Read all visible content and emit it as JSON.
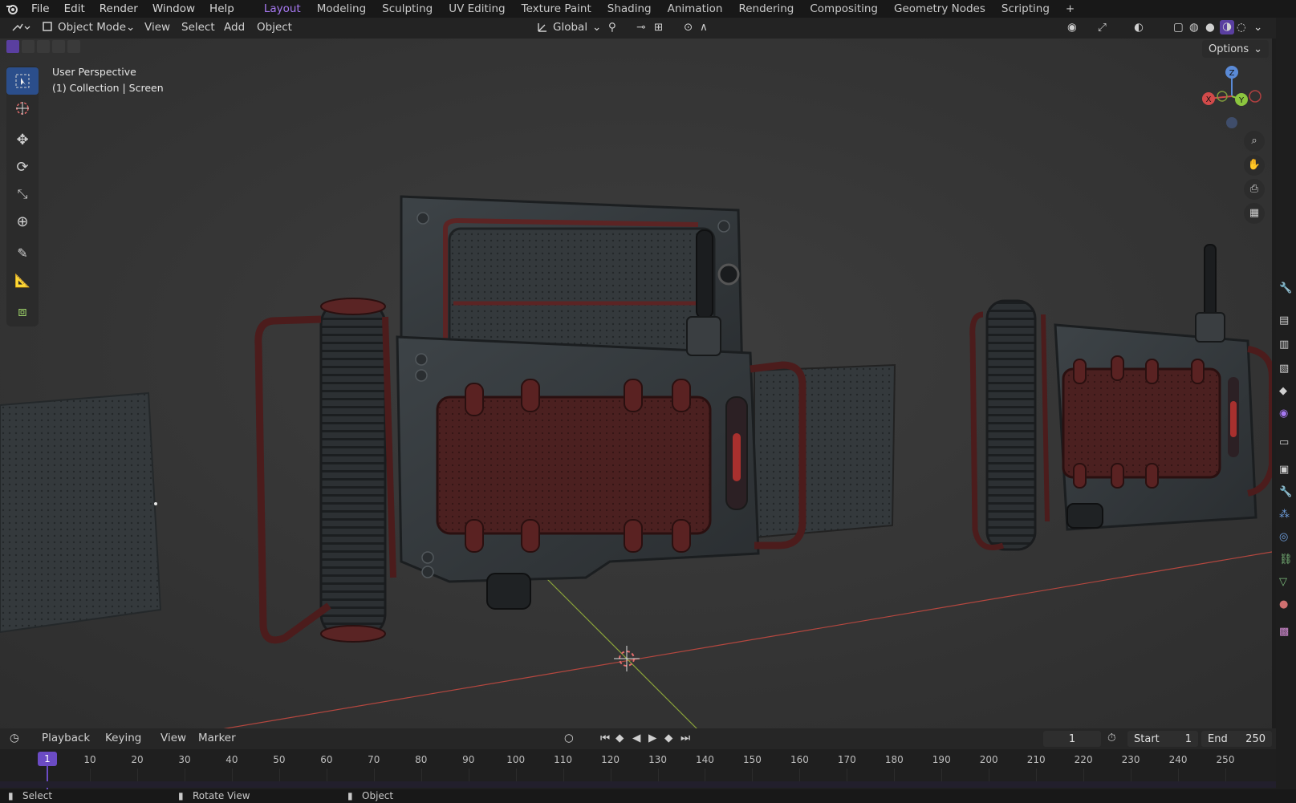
{
  "menu": {
    "file": "File",
    "edit": "Edit",
    "render": "Render",
    "window": "Window",
    "help": "Help"
  },
  "workspaces": [
    "Layout",
    "Modeling",
    "Sculpting",
    "UV Editing",
    "Texture Paint",
    "Shading",
    "Animation",
    "Rendering",
    "Compositing",
    "Geometry Nodes",
    "Scripting"
  ],
  "workspace_add": "+",
  "header": {
    "mode": "Object Mode",
    "view": "View",
    "select": "Select",
    "add": "Add",
    "object": "Object",
    "orientation": "Global",
    "options": "Options"
  },
  "viewport": {
    "perspective": "User Perspective",
    "collection": "(1) Collection | Screen",
    "gizmo": {
      "x": "X",
      "y": "Y",
      "z": "Z"
    }
  },
  "timeline": {
    "playback": "Playback",
    "keying": "Keying",
    "view": "View",
    "marker": "Marker",
    "current_frame": "1",
    "start_label": "Start",
    "start": "1",
    "end_label": "End",
    "end": "250",
    "ticks": [
      "10",
      "20",
      "30",
      "40",
      "50",
      "60",
      "70",
      "80",
      "90",
      "100",
      "110",
      "120",
      "130",
      "140",
      "150",
      "160",
      "170",
      "180",
      "190",
      "200",
      "210",
      "220",
      "230",
      "240",
      "250"
    ],
    "playhead": "1"
  },
  "status": {
    "select": "Select",
    "rotate": "Rotate View",
    "object": "Object"
  },
  "colors": {
    "accent": "#a779f2",
    "x_axis": "#d14a4a",
    "y_axis": "#8cc63f",
    "z_axis": "#5a8ad6"
  }
}
